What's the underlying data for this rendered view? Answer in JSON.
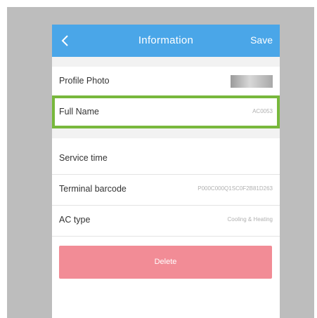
{
  "header": {
    "title": "Information",
    "save_label": "Save",
    "back_icon": "chevron-left-icon"
  },
  "rows": [
    {
      "label": "Profile Photo",
      "value": ""
    },
    {
      "label": "Full Name",
      "value": "AC0053"
    },
    {
      "label": "Service time",
      "value": ""
    },
    {
      "label": "Terminal barcode",
      "value": "P000C000Q1SC0F2B81D263"
    },
    {
      "label": "AC type",
      "value": "Cooling & Heating"
    }
  ],
  "delete_label": "Delete",
  "colors": {
    "header": "#4aa6e8",
    "delete": "#f28c96",
    "highlight": "#78b83c",
    "background": "#bdbdbd"
  }
}
